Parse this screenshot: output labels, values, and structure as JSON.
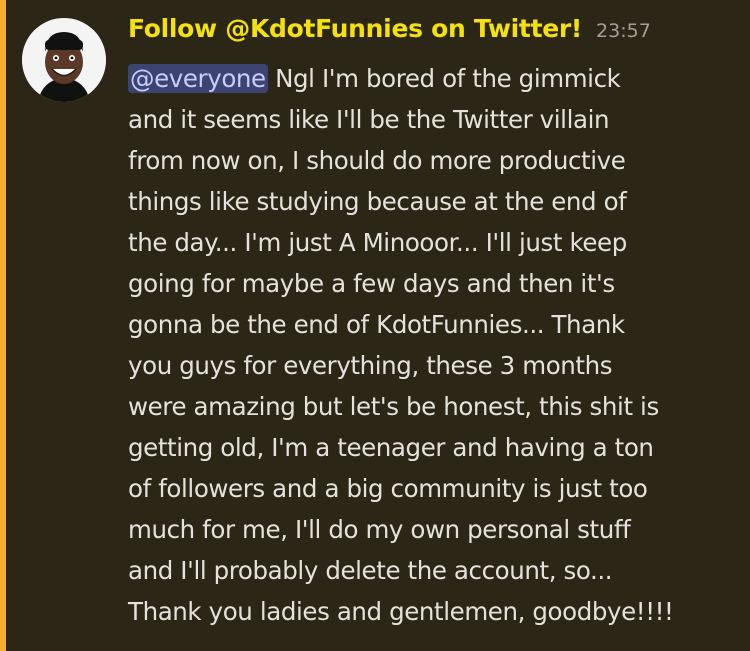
{
  "message": {
    "username": "Follow @KdotFunnies on Twitter!",
    "timestamp": "23:57",
    "mention": "@everyone",
    "lines": [
      " Ngl I'm bored of the gimmick",
      "and it seems like I'll be the Twitter villain",
      "from now on, I should do more productive",
      "things like studying because at the end of",
      "the day... I'm just A Minooor... I'll just keep",
      "going for maybe a few days and then it's",
      "gonna be the end of KdotFunnies... Thank",
      "you guys for everything, these 3 months",
      "were amazing but let's be honest, this shit is",
      "getting old, I'm a teenager and having a ton",
      "of followers and a big community is just too",
      "much for me, I'll do my own personal stuff",
      "and I'll probably delete the account, so...",
      "Thank you ladies and gentlemen, goodbye!!!!"
    ]
  },
  "colors": {
    "username": "#f5e10a",
    "mention_bg": "#3d4472",
    "mention_text": "#c9cdfb",
    "highlight": "#f0b132",
    "background": "#2b2616"
  }
}
